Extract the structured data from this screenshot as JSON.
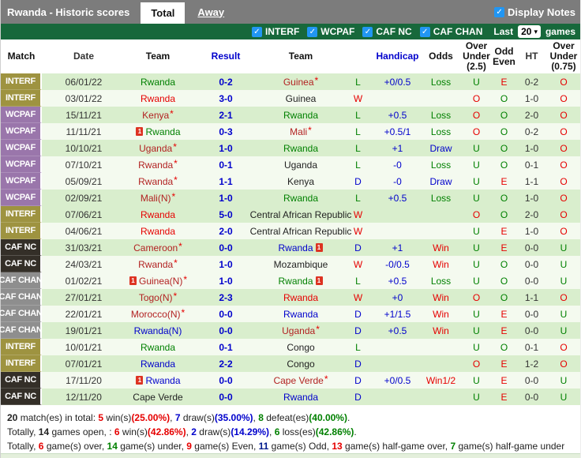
{
  "titlebar": {
    "title": "Rwanda - Historic scores",
    "tab_total": "Total",
    "tab_away": "Away",
    "display_notes": "Display Notes",
    "checkbox_glyph": "✓"
  },
  "filterbar": {
    "competitions": [
      "INTERF",
      "WCPAF",
      "CAF NC",
      "CAF CHAN"
    ],
    "last_label": "Last",
    "games_count": "20",
    "games_label": "games",
    "bar_color": "#17683b",
    "checkbox_color": "#2196f3"
  },
  "table": {
    "headers": {
      "match": "Match",
      "date": "Date",
      "team": "Team",
      "result": "Result",
      "team2": "Team",
      "handicap": "Handicap",
      "odds": "Odds",
      "ou25": "Over Under (2.5)",
      "oddeven": "Odd Even",
      "ht": "HT",
      "ou075": "Over Under (0.75)"
    },
    "comp_colors": {
      "INTERF": "#9e9340",
      "WCPAF": "#9a76ab",
      "CAF NC": "#342f28",
      "CAF CHAN": "#8e8e8e"
    },
    "red_card_count": "1",
    "rows": [
      {
        "comp": "INTERF",
        "shade": "g",
        "date": "06/01/22",
        "t1": "Rwanda",
        "t1c": "green",
        "t1s": false,
        "t1card": "",
        "score": "0-2",
        "t2": "Guinea",
        "t2c": "darkred",
        "t2s": true,
        "t2card": "",
        "wdl": "L",
        "hcap": "+0/0.5",
        "odds": "Loss",
        "ou": "U",
        "oe": "E",
        "ht": "0-2",
        "ou2": "O"
      },
      {
        "comp": "INTERF",
        "shade": "w",
        "date": "03/01/22",
        "t1": "Rwanda",
        "t1c": "red",
        "t1s": false,
        "t1card": "",
        "score": "3-0",
        "t2": "Guinea",
        "t2c": "black",
        "t2s": false,
        "t2card": "",
        "wdl": "W",
        "hcap": "",
        "odds": "",
        "ou": "O",
        "oe": "O",
        "ht": "1-0",
        "ou2": "O"
      },
      {
        "comp": "WCPAF",
        "shade": "g",
        "date": "15/11/21",
        "t1": "Kenya",
        "t1c": "darkred",
        "t1s": true,
        "t1card": "",
        "score": "2-1",
        "t2": "Rwanda",
        "t2c": "green",
        "t2s": false,
        "t2card": "",
        "wdl": "L",
        "hcap": "+0.5",
        "odds": "Loss",
        "ou": "O",
        "oe": "O",
        "ht": "2-0",
        "ou2": "O"
      },
      {
        "comp": "WCPAF",
        "shade": "w",
        "date": "11/11/21",
        "t1": "Rwanda",
        "t1c": "green",
        "t1s": false,
        "t1card": "b",
        "score": "0-3",
        "t2": "Mali",
        "t2c": "darkred",
        "t2s": true,
        "t2card": "",
        "wdl": "L",
        "hcap": "+0.5/1",
        "odds": "Loss",
        "ou": "O",
        "oe": "O",
        "ht": "0-2",
        "ou2": "O"
      },
      {
        "comp": "WCPAF",
        "shade": "g",
        "date": "10/10/21",
        "t1": "Uganda",
        "t1c": "darkred",
        "t1s": true,
        "t1card": "",
        "score": "1-0",
        "t2": "Rwanda",
        "t2c": "green",
        "t2s": false,
        "t2card": "",
        "wdl": "L",
        "hcap": "+1",
        "odds": "Draw",
        "ou": "U",
        "oe": "O",
        "ht": "1-0",
        "ou2": "O"
      },
      {
        "comp": "WCPAF",
        "shade": "w",
        "date": "07/10/21",
        "t1": "Rwanda",
        "t1c": "darkred",
        "t1s": true,
        "t1card": "",
        "score": "0-1",
        "t2": "Uganda",
        "t2c": "black",
        "t2s": false,
        "t2card": "",
        "wdl": "L",
        "hcap": "-0",
        "odds": "Loss",
        "ou": "U",
        "oe": "O",
        "ht": "0-1",
        "ou2": "O"
      },
      {
        "comp": "WCPAF",
        "shade": "w",
        "date": "05/09/21",
        "t1": "Rwanda",
        "t1c": "darkred",
        "t1s": true,
        "t1card": "",
        "score": "1-1",
        "t2": "Kenya",
        "t2c": "black",
        "t2s": false,
        "t2card": "",
        "wdl": "D",
        "hcap": "-0",
        "odds": "Draw",
        "ou": "U",
        "oe": "E",
        "ht": "1-1",
        "ou2": "O"
      },
      {
        "comp": "WCPAF",
        "shade": "g",
        "date": "02/09/21",
        "t1": "Mali(N)",
        "t1c": "darkred",
        "t1s": true,
        "t1card": "",
        "score": "1-0",
        "t2": "Rwanda",
        "t2c": "green",
        "t2s": false,
        "t2card": "",
        "wdl": "L",
        "hcap": "+0.5",
        "odds": "Loss",
        "ou": "U",
        "oe": "O",
        "ht": "1-0",
        "ou2": "O"
      },
      {
        "comp": "INTERF",
        "shade": "g",
        "date": "07/06/21",
        "t1": "Rwanda",
        "t1c": "red",
        "t1s": false,
        "t1card": "",
        "score": "5-0",
        "t2": "Central African Republic",
        "t2c": "black",
        "t2s": false,
        "t2card": "",
        "wdl": "W",
        "hcap": "",
        "odds": "",
        "ou": "O",
        "oe": "O",
        "ht": "2-0",
        "ou2": "O"
      },
      {
        "comp": "INTERF",
        "shade": "w",
        "date": "04/06/21",
        "t1": "Rwanda",
        "t1c": "red",
        "t1s": false,
        "t1card": "",
        "score": "2-0",
        "t2": "Central African Republic",
        "t2c": "black",
        "t2s": false,
        "t2card": "",
        "wdl": "W",
        "hcap": "",
        "odds": "",
        "ou": "U",
        "oe": "E",
        "ht": "1-0",
        "ou2": "O"
      },
      {
        "comp": "CAF NC",
        "shade": "g",
        "date": "31/03/21",
        "t1": "Cameroon",
        "t1c": "darkred",
        "t1s": true,
        "t1card": "",
        "score": "0-0",
        "t2": "Rwanda",
        "t2c": "blue",
        "t2s": false,
        "t2card": "a",
        "wdl": "D",
        "hcap": "+1",
        "odds": "Win",
        "ou": "U",
        "oe": "E",
        "ht": "0-0",
        "ou2": "U"
      },
      {
        "comp": "CAF NC",
        "shade": "w",
        "date": "24/03/21",
        "t1": "Rwanda",
        "t1c": "darkred",
        "t1s": true,
        "t1card": "",
        "score": "1-0",
        "t2": "Mozambique",
        "t2c": "black",
        "t2s": false,
        "t2card": "",
        "wdl": "W",
        "hcap": "-0/0.5",
        "odds": "Win",
        "ou": "U",
        "oe": "O",
        "ht": "0-0",
        "ou2": "U"
      },
      {
        "comp": "CAF CHAN",
        "shade": "w",
        "date": "01/02/21",
        "t1": "Guinea(N)",
        "t1c": "darkred",
        "t1s": true,
        "t1card": "b",
        "score": "1-0",
        "t2": "Rwanda",
        "t2c": "green",
        "t2s": false,
        "t2card": "a",
        "wdl": "L",
        "hcap": "+0.5",
        "odds": "Loss",
        "ou": "U",
        "oe": "O",
        "ht": "0-0",
        "ou2": "U"
      },
      {
        "comp": "CAF CHAN",
        "shade": "g",
        "date": "27/01/21",
        "t1": "Togo(N)",
        "t1c": "darkred",
        "t1s": true,
        "t1card": "",
        "score": "2-3",
        "t2": "Rwanda",
        "t2c": "red",
        "t2s": false,
        "t2card": "",
        "wdl": "W",
        "hcap": "+0",
        "odds": "Win",
        "ou": "O",
        "oe": "O",
        "ht": "1-1",
        "ou2": "O"
      },
      {
        "comp": "CAF CHAN",
        "shade": "w",
        "date": "22/01/21",
        "t1": "Morocco(N)",
        "t1c": "darkred",
        "t1s": true,
        "t1card": "",
        "score": "0-0",
        "t2": "Rwanda",
        "t2c": "blue",
        "t2s": false,
        "t2card": "",
        "wdl": "D",
        "hcap": "+1/1.5",
        "odds": "Win",
        "ou": "U",
        "oe": "E",
        "ht": "0-0",
        "ou2": "U"
      },
      {
        "comp": "CAF CHAN",
        "shade": "g",
        "date": "19/01/21",
        "t1": "Rwanda(N)",
        "t1c": "blue",
        "t1s": false,
        "t1card": "",
        "score": "0-0",
        "t2": "Uganda",
        "t2c": "darkred",
        "t2s": true,
        "t2card": "",
        "wdl": "D",
        "hcap": "+0.5",
        "odds": "Win",
        "ou": "U",
        "oe": "E",
        "ht": "0-0",
        "ou2": "U"
      },
      {
        "comp": "INTERF",
        "shade": "w",
        "date": "10/01/21",
        "t1": "Rwanda",
        "t1c": "green",
        "t1s": false,
        "t1card": "",
        "score": "0-1",
        "t2": "Congo",
        "t2c": "black",
        "t2s": false,
        "t2card": "",
        "wdl": "L",
        "hcap": "",
        "odds": "",
        "ou": "U",
        "oe": "O",
        "ht": "0-1",
        "ou2": "O"
      },
      {
        "comp": "INTERF",
        "shade": "g",
        "date": "07/01/21",
        "t1": "Rwanda",
        "t1c": "blue",
        "t1s": false,
        "t1card": "",
        "score": "2-2",
        "t2": "Congo",
        "t2c": "black",
        "t2s": false,
        "t2card": "",
        "wdl": "D",
        "hcap": "",
        "odds": "",
        "ou": "O",
        "oe": "E",
        "ht": "1-2",
        "ou2": "O"
      },
      {
        "comp": "CAF NC",
        "shade": "w",
        "date": "17/11/20",
        "t1": "Rwanda",
        "t1c": "blue",
        "t1s": false,
        "t1card": "b",
        "score": "0-0",
        "t2": "Cape Verde",
        "t2c": "darkred",
        "t2s": true,
        "t2card": "",
        "wdl": "D",
        "hcap": "+0/0.5",
        "odds": "Win1/2",
        "ou": "U",
        "oe": "E",
        "ht": "0-0",
        "ou2": "U"
      },
      {
        "comp": "CAF NC",
        "shade": "g",
        "date": "12/11/20",
        "t1": "Cape Verde",
        "t1c": "black",
        "t1s": false,
        "t1card": "",
        "score": "0-0",
        "t2": "Rwanda",
        "t2c": "blue",
        "t2s": false,
        "t2card": "",
        "wdl": "D",
        "hcap": "",
        "odds": "",
        "ou": "U",
        "oe": "E",
        "ht": "0-0",
        "ou2": "U"
      }
    ]
  },
  "footer": {
    "line1": [
      {
        "t": "20",
        "c": "k",
        "b": true
      },
      {
        "t": " match(es) in total: ",
        "c": "k"
      },
      {
        "t": "5",
        "c": "r",
        "b": true
      },
      {
        "t": " win(s)",
        "c": "k"
      },
      {
        "t": "(25.00%)",
        "c": "r",
        "b": true
      },
      {
        "t": ", ",
        "c": "k"
      },
      {
        "t": "7",
        "c": "b",
        "b": true
      },
      {
        "t": " draw(s)",
        "c": "k"
      },
      {
        "t": "(35.00%)",
        "c": "b",
        "b": true
      },
      {
        "t": ", ",
        "c": "k"
      },
      {
        "t": "8",
        "c": "g",
        "b": true
      },
      {
        "t": " defeat(es)",
        "c": "k"
      },
      {
        "t": "(40.00%)",
        "c": "g",
        "b": true
      },
      {
        "t": ".",
        "c": "k"
      }
    ],
    "line2": [
      {
        "t": "Totally, ",
        "c": "k"
      },
      {
        "t": "14",
        "c": "k",
        "b": true
      },
      {
        "t": " games open, : ",
        "c": "k"
      },
      {
        "t": "6",
        "c": "r",
        "b": true
      },
      {
        "t": " win(s)",
        "c": "k"
      },
      {
        "t": "(42.86%)",
        "c": "r",
        "b": true
      },
      {
        "t": ", ",
        "c": "k"
      },
      {
        "t": "2",
        "c": "b",
        "b": true
      },
      {
        "t": " draw(s)",
        "c": "k"
      },
      {
        "t": "(14.29%)",
        "c": "b",
        "b": true
      },
      {
        "t": ", ",
        "c": "k"
      },
      {
        "t": "6",
        "c": "g",
        "b": true
      },
      {
        "t": " loss(es)",
        "c": "k"
      },
      {
        "t": "(42.86%)",
        "c": "g",
        "b": true
      },
      {
        "t": ".",
        "c": "k"
      }
    ],
    "line3": [
      {
        "t": "Totally, ",
        "c": "k"
      },
      {
        "t": "6",
        "c": "r",
        "b": true
      },
      {
        "t": " game(s) over, ",
        "c": "k"
      },
      {
        "t": "14",
        "c": "g",
        "b": true
      },
      {
        "t": " game(s) under, ",
        "c": "k"
      },
      {
        "t": "9",
        "c": "r",
        "b": true
      },
      {
        "t": " game(s) Even, ",
        "c": "k"
      },
      {
        "t": "11",
        "c": "n",
        "b": true
      },
      {
        "t": " game(s) Odd, ",
        "c": "k"
      },
      {
        "t": "13",
        "c": "r",
        "b": true
      },
      {
        "t": " game(s) half-game over, ",
        "c": "k"
      },
      {
        "t": "7",
        "c": "g",
        "b": true
      },
      {
        "t": " game(s) half-game under",
        "c": "k"
      }
    ]
  }
}
